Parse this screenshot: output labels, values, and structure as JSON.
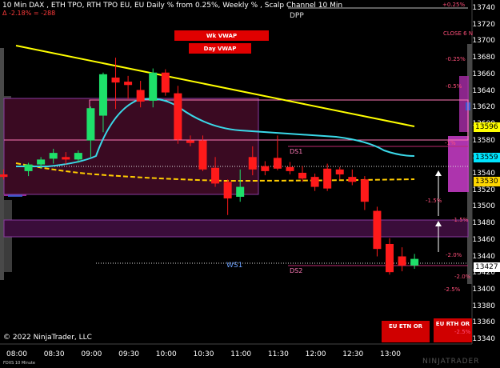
{
  "header": {
    "title": "10 Min DAX , ETH TPO, RTH TPO EU, EU Daily % from 0.25%, Weekly % , Scalp Channel 10 Min",
    "change": "Δ -2.18% = -288"
  },
  "buttons": {
    "wk_vwap": "Wk VWAP",
    "day_vwap": "Day VWAP",
    "eu_eth_or": "EU ETN OR",
    "eu_rth_or": "EU RTH OR"
  },
  "levels": {
    "dpp": "DPP",
    "ds1": "DS1",
    "ds2": "DS2",
    "ws1": "WS1",
    "close": "CLOSE 6 N"
  },
  "percent_labels": [
    "+0.25%",
    "-0.25%",
    "-0.5%",
    "-1%",
    "-1.5%",
    "-1.5%",
    "-2.0%",
    "-2.0%",
    "-2.5%",
    "-2.5%"
  ],
  "price_axis": [
    "13740",
    "13720",
    "13700",
    "13680",
    "13660",
    "13640",
    "13620",
    "13600",
    "13580",
    "13560",
    "13540",
    "13520",
    "13500",
    "13480",
    "13460",
    "13440",
    "13420",
    "13400",
    "13380",
    "13360",
    "13340"
  ],
  "price_badges": [
    {
      "value": "13596",
      "color": "#ffff00",
      "text_color": "#000"
    },
    {
      "value": "13559",
      "color": "#00e5ff",
      "text_color": "#000"
    },
    {
      "value": "13530",
      "color": "#ffd700",
      "text_color": "#000"
    },
    {
      "value": "13427",
      "color": "#ffffff",
      "text_color": "#000"
    }
  ],
  "time_axis": [
    "08:00",
    "08:30",
    "09:00",
    "09:30",
    "10:00",
    "10:30",
    "11:00",
    "11:30",
    "12:00",
    "12:30",
    "13:00"
  ],
  "footer": {
    "copyright": "© 2022 NinjaTrader, LLC",
    "instrument": "FDXS 10 Minute",
    "brand": "NINJATRADER"
  },
  "colors": {
    "bull": "#1ee06a",
    "bear": "#ff1a1a",
    "trend": "#ffff00",
    "vwap": "#3ad8e8",
    "band": "#5a0a2a"
  },
  "candles": [
    {
      "t": "07:50",
      "o": 13539,
      "h": 13545,
      "l": 13533,
      "c": 13536
    },
    {
      "t": "08:10",
      "o": 13543,
      "h": 13553,
      "l": 13537,
      "c": 13551
    },
    {
      "t": "08:20",
      "o": 13551,
      "h": 13560,
      "l": 13546,
      "c": 13557
    },
    {
      "t": "08:30",
      "o": 13558,
      "h": 13570,
      "l": 13552,
      "c": 13565
    },
    {
      "t": "08:40",
      "o": 13560,
      "h": 13566,
      "l": 13551,
      "c": 13557
    },
    {
      "t": "08:50",
      "o": 13557,
      "h": 13568,
      "l": 13553,
      "c": 13565
    },
    {
      "t": "09:00",
      "o": 13580,
      "h": 13621,
      "l": 13560,
      "c": 13619
    },
    {
      "t": "09:10",
      "o": 13610,
      "h": 13662,
      "l": 13590,
      "c": 13660
    },
    {
      "t": "09:20",
      "o": 13656,
      "h": 13680,
      "l": 13618,
      "c": 13650
    },
    {
      "t": "09:30",
      "o": 13651,
      "h": 13658,
      "l": 13630,
      "c": 13647
    },
    {
      "t": "09:40",
      "o": 13641,
      "h": 13652,
      "l": 13620,
      "c": 13627
    },
    {
      "t": "09:50",
      "o": 13628,
      "h": 13667,
      "l": 13620,
      "c": 13662
    },
    {
      "t": "10:00",
      "o": 13662,
      "h": 13666,
      "l": 13634,
      "c": 13638
    },
    {
      "t": "10:10",
      "o": 13637,
      "h": 13646,
      "l": 13576,
      "c": 13581
    },
    {
      "t": "10:20",
      "o": 13580,
      "h": 13586,
      "l": 13573,
      "c": 13577
    },
    {
      "t": "10:30",
      "o": 13580,
      "h": 13586,
      "l": 13543,
      "c": 13545
    },
    {
      "t": "10:40",
      "o": 13547,
      "h": 13560,
      "l": 13524,
      "c": 13528
    },
    {
      "t": "10:50",
      "o": 13530,
      "h": 13533,
      "l": 13490,
      "c": 13510
    },
    {
      "t": "11:00",
      "o": 13512,
      "h": 13545,
      "l": 13506,
      "c": 13524
    },
    {
      "t": "11:10",
      "o": 13560,
      "h": 13573,
      "l": 13538,
      "c": 13545
    },
    {
      "t": "11:20",
      "o": 13549,
      "h": 13555,
      "l": 13538,
      "c": 13543
    },
    {
      "t": "11:30",
      "o": 13559,
      "h": 13586,
      "l": 13544,
      "c": 13546
    },
    {
      "t": "11:40",
      "o": 13548,
      "h": 13554,
      "l": 13539,
      "c": 13543
    },
    {
      "t": "11:50",
      "o": 13541,
      "h": 13549,
      "l": 13530,
      "c": 13534
    },
    {
      "t": "12:00",
      "o": 13536,
      "h": 13540,
      "l": 13519,
      "c": 13524
    },
    {
      "t": "12:10",
      "o": 13546,
      "h": 13552,
      "l": 13519,
      "c": 13522
    },
    {
      "t": "12:20",
      "o": 13545,
      "h": 13548,
      "l": 13533,
      "c": 13539
    },
    {
      "t": "12:30",
      "o": 13536,
      "h": 13545,
      "l": 13526,
      "c": 13530
    },
    {
      "t": "12:40",
      "o": 13533,
      "h": 13537,
      "l": 13496,
      "c": 13506
    },
    {
      "t": "12:50",
      "o": 13495,
      "h": 13500,
      "l": 13440,
      "c": 13449
    },
    {
      "t": "13:00",
      "o": 13455,
      "h": 13462,
      "l": 13418,
      "c": 13421
    },
    {
      "t": "13:10",
      "o": 13440,
      "h": 13451,
      "l": 13422,
      "c": 13429
    },
    {
      "t": "13:20",
      "o": 13429,
      "h": 13443,
      "l": 13425,
      "c": 13437
    }
  ],
  "chart_data": {
    "type": "candlestick",
    "title": "10 Min DAX , ETH TPO, RTH TPO EU, EU Daily % from 0.25%, Weekly % , Scalp Channel 10 Min",
    "ylim": [
      13340,
      13750
    ],
    "x": [
      "08:00",
      "08:30",
      "09:00",
      "09:30",
      "10:00",
      "10:30",
      "11:00",
      "11:30",
      "12:00",
      "12:30",
      "13:00"
    ],
    "series": [
      {
        "name": "",
        "values": []
      }
    ],
    "grid": false
  }
}
